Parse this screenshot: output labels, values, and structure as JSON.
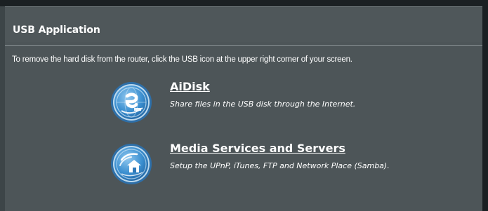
{
  "section": {
    "title": "USB Application",
    "instruction": "To remove the hard disk from the router, click the USB icon at the upper right corner of your screen."
  },
  "services": [
    {
      "title": "AiDisk",
      "description": "Share files in the USB disk through the Internet.",
      "icon": "aidisk-globe-icon"
    },
    {
      "title": "Media Services and Servers",
      "description": "Setup the UPnP, iTunes, FTP and Network Place (Samba).",
      "icon": "media-server-house-icon"
    }
  ],
  "colors": {
    "panel_bg": "#4d5558",
    "text": "#ffffff",
    "icon_blue": "#3b8fd0"
  }
}
